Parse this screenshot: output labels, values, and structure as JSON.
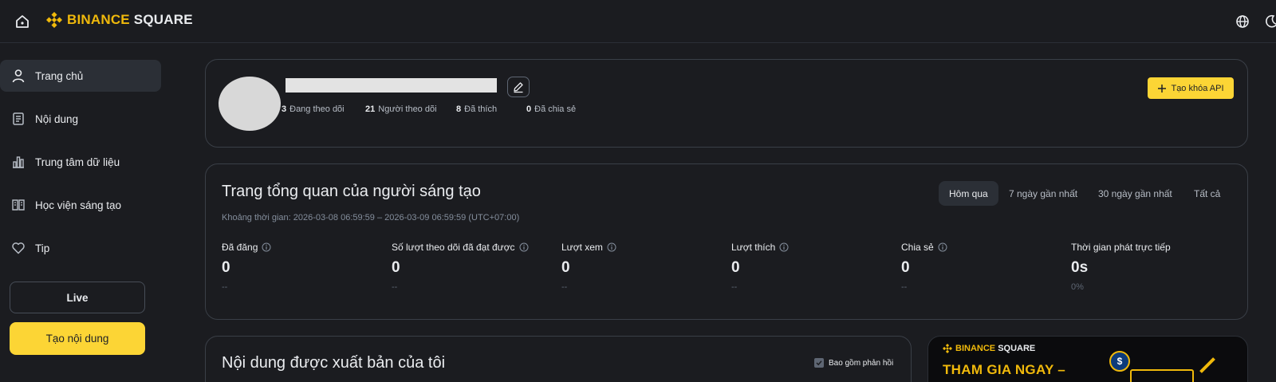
{
  "header": {
    "logo_brand": "BINANCE",
    "logo_product": "SQUARE",
    "brand_color": "#F0B90B",
    "icons": [
      "home-icon",
      "globe-icon",
      "moon-icon"
    ]
  },
  "sidebar": {
    "items": [
      {
        "label": "Trang chủ",
        "icon": "user-icon",
        "active": true
      },
      {
        "label": "Nội dung",
        "icon": "document-icon",
        "active": false
      },
      {
        "label": "Trung tâm dữ liệu",
        "icon": "bar-chart-icon",
        "active": false
      },
      {
        "label": "Học viện sáng tạo",
        "icon": "book-icon",
        "active": false
      },
      {
        "label": "Tip",
        "icon": "heart-icon",
        "active": false
      }
    ],
    "live_label": "Live",
    "create_label": "Tạo nội dung"
  },
  "profile": {
    "stats": [
      {
        "value": "3",
        "label": "Đang theo dõi"
      },
      {
        "value": "21",
        "label": "Người theo dõi"
      },
      {
        "value": "8",
        "label": "Đã thích"
      },
      {
        "value": "0",
        "label": "Đã chia sẻ"
      }
    ],
    "api_button_label": "Tạo khóa API"
  },
  "overview": {
    "title": "Trang tổng quan của người sáng tạo",
    "period": "Khoảng thời gian: 2026-03-08 06:59:59 – 2026-03-09 06:59:59 (UTC+07:00)",
    "ranges": [
      {
        "label": "Hôm qua",
        "active": true
      },
      {
        "label": "7 ngày gần nhất",
        "active": false
      },
      {
        "label": "30 ngày gần nhất",
        "active": false
      },
      {
        "label": "Tất cả",
        "active": false
      }
    ],
    "metrics": [
      {
        "label": "Đã đăng",
        "value": "0",
        "sub": "--",
        "info": true
      },
      {
        "label": "Số lượt theo dõi đã đạt được",
        "value": "0",
        "sub": "--",
        "info": true
      },
      {
        "label": "Lượt xem",
        "value": "0",
        "sub": "--",
        "info": true
      },
      {
        "label": "Lượt thích",
        "value": "0",
        "sub": "--",
        "info": true
      },
      {
        "label": "Chia sẻ",
        "value": "0",
        "sub": "--",
        "info": true
      },
      {
        "label": "Thời gian phát trực tiếp",
        "value": "0s",
        "sub": "0%",
        "info": false
      }
    ]
  },
  "published": {
    "title": "Nội dung được xuất bản của tôi",
    "include_replies_label": "Bao gồm phản hồi",
    "include_replies_checked": true
  },
  "promo": {
    "logo_brand": "BINANCE",
    "logo_product": "SQUARE",
    "headline": "THAM GIA NGAY –",
    "coin_symbol": "$"
  }
}
